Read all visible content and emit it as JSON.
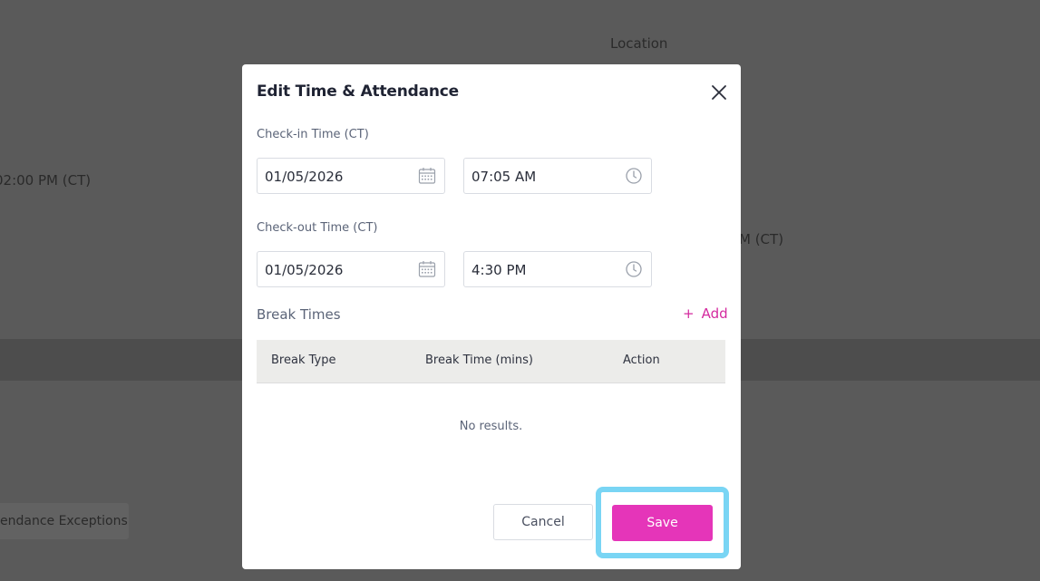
{
  "background": {
    "location_label": "Location",
    "time_left": "02:00 PM (CT)",
    "time_right": "M (CT)",
    "exceptions_button": "endance Exceptions"
  },
  "modal": {
    "title": "Edit Time & Attendance",
    "checkin": {
      "label": "Check-in Time (CT)",
      "date": "01/05/2026",
      "time": "07:05 AM"
    },
    "checkout": {
      "label": "Check-out Time (CT)",
      "date": "01/05/2026",
      "time": "4:30 PM"
    },
    "breaks": {
      "title": "Break Times",
      "add_plus": "+",
      "add_label": "Add",
      "columns": [
        "Break Type",
        "Break Time (mins)",
        "Action"
      ],
      "empty_text": "No results."
    },
    "cancel_label": "Cancel",
    "save_label": "Save"
  },
  "colors": {
    "accent": "#e535b9",
    "highlight": "#79d5f4",
    "overlay": "#5a5a5a"
  },
  "icons": [
    "calendar-icon",
    "clock-icon",
    "close-icon"
  ]
}
